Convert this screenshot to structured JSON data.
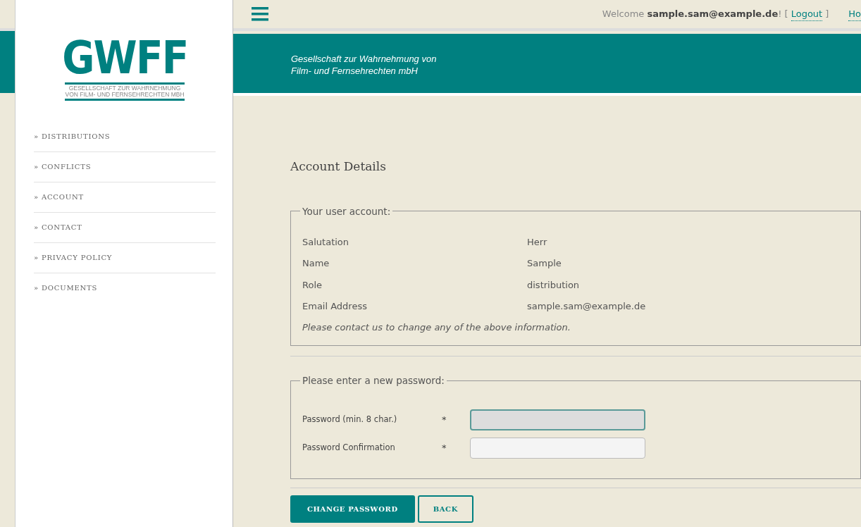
{
  "logo": {
    "title": "GWFF",
    "subtitle_lines": [
      "GESELLSCHAFT ZUR WAHRNEHMUNG",
      "VON FILM- UND FERNSEHRECHTEN MBH"
    ]
  },
  "sidebar": {
    "items": [
      {
        "label": "» DISTRIBUTIONS",
        "selected": false
      },
      {
        "label": "» CONFLICTS",
        "selected": false
      },
      {
        "label": "» ACCOUNT",
        "selected": false
      },
      {
        "label": "» CONTACT",
        "selected": false
      },
      {
        "label": "» PRIVACY POLICY",
        "selected": false
      },
      {
        "label": "» DOCUMENTS",
        "selected": false
      }
    ]
  },
  "topbar": {
    "welcome": "Welcome",
    "user": "sample.sam@example.de",
    "after_user": "! [",
    "logout": "Logout",
    "close_bracket": "]",
    "cut_link": "Ho"
  },
  "banner": {
    "lines": [
      "Gesellschaft zur Wahrnehmung von",
      "Film- und Fernsehrechten mbH"
    ]
  },
  "page_title": "Account Details",
  "account": {
    "legend": "Your user account:",
    "rows": [
      {
        "label": "Salutation",
        "value": "Herr"
      },
      {
        "label": "Name",
        "value": "Sample"
      },
      {
        "label": "Role",
        "value": "distribution"
      },
      {
        "label": "Email Address",
        "value": "sample.sam@example.de"
      }
    ],
    "note": "Please contact us to change any of the above information."
  },
  "password": {
    "legend": "Please enter a new password:",
    "fields": [
      {
        "label": "Password (min. 8 char.)",
        "required_mark": "*",
        "focused": true
      },
      {
        "label": "Password Confirmation",
        "required_mark": "*",
        "focused": false
      }
    ]
  },
  "buttons": [
    {
      "label": "CHANGE PASSWORD",
      "kind": "primary"
    },
    {
      "label": "BACK",
      "kind": "outline"
    }
  ]
}
